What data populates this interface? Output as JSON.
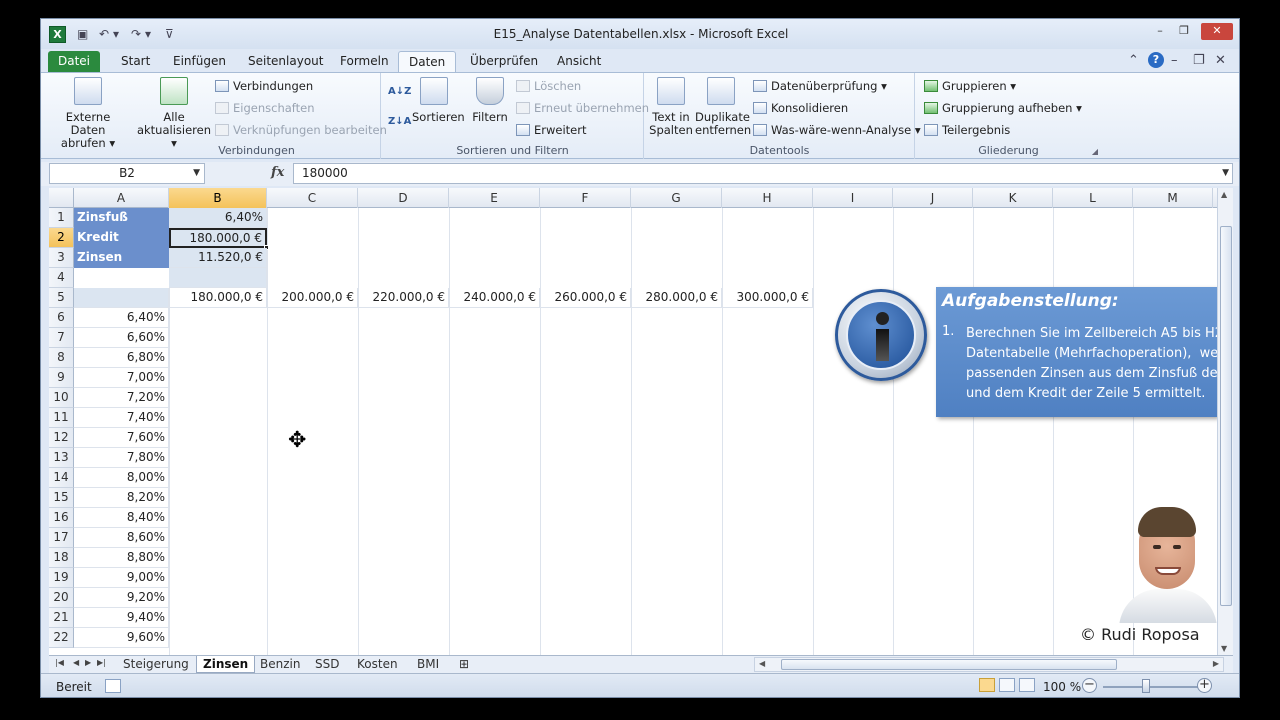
{
  "window": {
    "title": "E15_Analyse Datentabellen.xlsx  -  Microsoft Excel",
    "controls": [
      "–",
      "❐",
      "✕"
    ]
  },
  "tabs": [
    "Datei",
    "Start",
    "Einfügen",
    "Seitenlayout",
    "Formeln",
    "Daten",
    "Überprüfen",
    "Ansicht"
  ],
  "active_tab": "Daten",
  "ribbon": {
    "externe_daten": "Externe Daten abrufen",
    "alle_aktualisieren": "Alle aktualisieren",
    "verbindungen": "Verbindungen",
    "eigenschaften": "Eigenschaften",
    "verknuepfungen": "Verknüpfungen bearbeiten",
    "group_verbindungen": "Verbindungen",
    "sort_az": "A↓Z",
    "sort_za": "Z↓A",
    "sortieren": "Sortieren",
    "filtern": "Filtern",
    "loeschen": "Löschen",
    "erneut": "Erneut übernehmen",
    "erweitert": "Erweitert",
    "group_sortieren": "Sortieren und Filtern",
    "text_in_spalten": "Text in Spalten",
    "duplikate": "Duplikate entfernen",
    "datenueberpruefung": "Datenüberprüfung",
    "konsolidieren": "Konsolidieren",
    "was_waere_wenn": "Was-wäre-wenn-Analyse",
    "group_datentools": "Datentools",
    "gruppieren": "Gruppieren",
    "gruppierung_aufheben": "Gruppierung aufheben",
    "teilergebnis": "Teilergebnis",
    "group_gliederung": "Gliederung"
  },
  "formula_bar": {
    "name_box": "B2",
    "fx": "fx",
    "formula": "180000"
  },
  "columns": [
    "A",
    "B",
    "C",
    "D",
    "E",
    "F",
    "G",
    "H",
    "I",
    "J",
    "K",
    "L",
    "M"
  ],
  "selected_column": "B",
  "rows": [
    "1",
    "2",
    "3",
    "4",
    "5",
    "6",
    "7",
    "8",
    "9",
    "10",
    "11",
    "12",
    "13",
    "14",
    "15",
    "16",
    "17",
    "18",
    "19",
    "20",
    "21",
    "22"
  ],
  "selected_row": "2",
  "cells": {
    "A1": "Zinsfuß",
    "B1": "6,40%",
    "A2": "Kredit",
    "B2": "180.000,0 €",
    "A3": "Zinsen",
    "B3": "11.520,0 €",
    "B5": "180.000,0 €",
    "C5": "200.000,0 €",
    "D5": "220.000,0 €",
    "E5": "240.000,0 €",
    "F5": "260.000,0 €",
    "G5": "280.000,0 €",
    "H5": "300.000,0 €"
  },
  "rates": [
    "6,40%",
    "6,60%",
    "6,80%",
    "7,00%",
    "7,20%",
    "7,40%",
    "7,60%",
    "7,80%",
    "8,00%",
    "8,20%",
    "8,40%",
    "8,60%",
    "8,80%",
    "9,00%",
    "9,20%",
    "9,40%",
    "9,60%"
  ],
  "info": {
    "title": "Aufgabenstellung:",
    "number": "1.",
    "text": "Berechnen Sie im Zellbereich A5 bis H2\nDatentabelle (Mehrfachoperation),  we\npassenden Zinsen aus dem Zinsfuß der\nund dem Kredit der Zeile 5 ermittelt."
  },
  "copyright": "© Rudi Roposa",
  "sheets": [
    "Steigerung",
    "Zinsen",
    "Benzin",
    "SSD",
    "Kosten",
    "BMI"
  ],
  "active_sheet": "Zinsen",
  "status": {
    "ready": "Bereit",
    "zoom": "100 %"
  },
  "colors": {
    "label_fill": "#6b8fcc",
    "input_fill": "#dbe5f1",
    "selection_header": "#f4c25a",
    "info_box": "#5b8ac8",
    "file_tab": "#2b8a3e"
  }
}
